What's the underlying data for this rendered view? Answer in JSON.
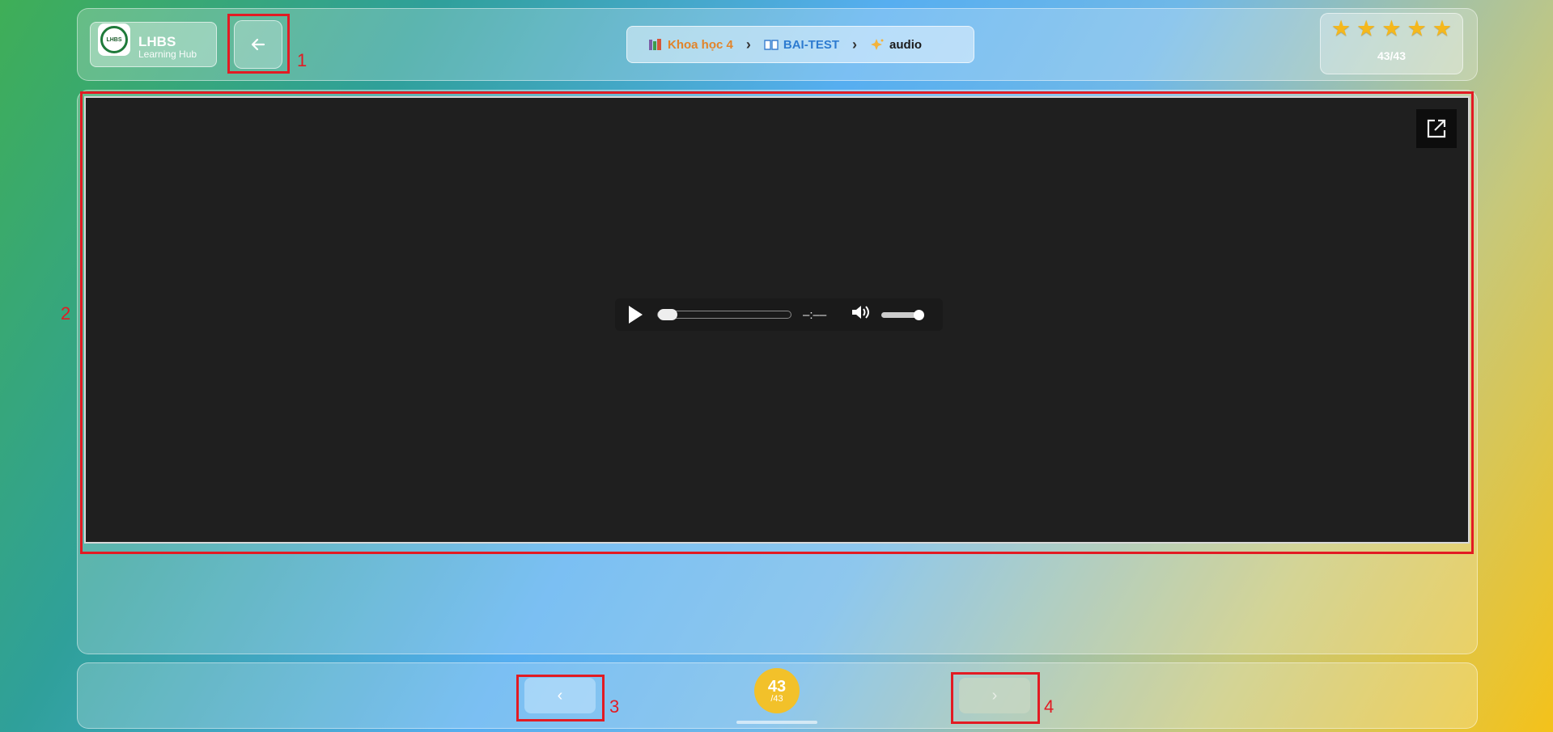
{
  "app": {
    "logo_seal": "LHBS",
    "title": "LHBS",
    "subtitle": "Learning Hub"
  },
  "header": {
    "back_icon": "arrow-left-icon",
    "breadcrumb": [
      {
        "icon": "books-icon",
        "label": "Khoa học 4",
        "color": "#e2842a"
      },
      {
        "icon": "book-icon",
        "label": "BAI-TEST",
        "color": "#2d7bd0"
      },
      {
        "icon": "sparkle-icon",
        "label": "audio",
        "color": "#1b1b1b"
      }
    ],
    "stars": {
      "rating": 5,
      "max": 5,
      "count_text": "43/43"
    }
  },
  "player": {
    "time_display": "–:––",
    "progress": 0,
    "volume": 1.0,
    "popout_icon": "external-link-icon"
  },
  "footer": {
    "prev_label": "‹",
    "next_label": "›",
    "page_current": "43",
    "page_total": "/43"
  },
  "annotations": [
    "1",
    "2",
    "3",
    "4"
  ],
  "colors": {
    "annotation": "#e21b23",
    "star": "#f5b81c",
    "page_bubble": "#f2c12a"
  }
}
